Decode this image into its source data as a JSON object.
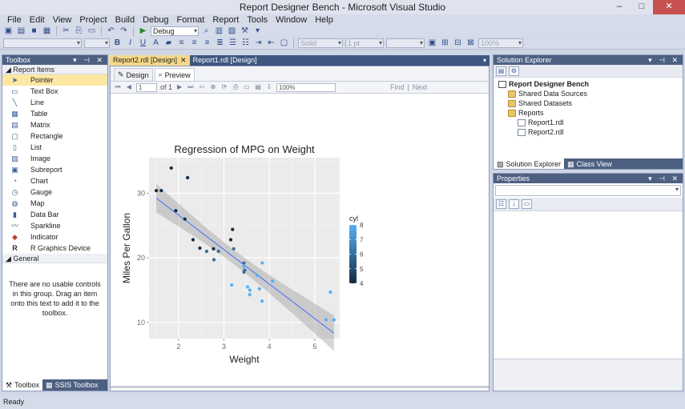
{
  "window": {
    "title": "Report Designer Bench - Microsoft Visual Studio",
    "controls": [
      "–",
      "□",
      "✕"
    ]
  },
  "menu": [
    "File",
    "Edit",
    "View",
    "Project",
    "Build",
    "Debug",
    "Format",
    "Report",
    "Tools",
    "Window",
    "Help"
  ],
  "toolbar": {
    "config": "Debug",
    "line_style": "Solid",
    "line_width": "1 pt",
    "zoom": "100%"
  },
  "toolbox": {
    "title": "Toolbox",
    "group_title": "Report Items",
    "items": [
      {
        "label": "Pointer",
        "icon": "pointer-icon"
      },
      {
        "label": "Text Box",
        "icon": "textbox-icon"
      },
      {
        "label": "Line",
        "icon": "line-icon"
      },
      {
        "label": "Table",
        "icon": "table-icon"
      },
      {
        "label": "Matrix",
        "icon": "matrix-icon"
      },
      {
        "label": "Rectangle",
        "icon": "rectangle-icon"
      },
      {
        "label": "List",
        "icon": "list-icon"
      },
      {
        "label": "Image",
        "icon": "image-icon"
      },
      {
        "label": "Subreport",
        "icon": "subreport-icon"
      },
      {
        "label": "Chart",
        "icon": "chart-icon"
      },
      {
        "label": "Gauge",
        "icon": "gauge-icon"
      },
      {
        "label": "Map",
        "icon": "map-icon"
      },
      {
        "label": "Data Bar",
        "icon": "databar-icon"
      },
      {
        "label": "Sparkline",
        "icon": "sparkline-icon"
      },
      {
        "label": "Indicator",
        "icon": "indicator-icon"
      },
      {
        "label": "R Graphics Device",
        "icon": "r-icon"
      }
    ],
    "general_title": "General",
    "general_note": "There are no usable controls in this group. Drag an item onto this text to add it to the toolbox.",
    "tabs": [
      "Toolbox",
      "SSIS Toolbox"
    ]
  },
  "documents": {
    "tabs": [
      "Report2.rdl [Design]",
      "Report1.rdl [Design]"
    ],
    "view_tabs": [
      "Design",
      "Preview"
    ]
  },
  "report_toolbar": {
    "page": "1",
    "of_label": "of 1",
    "zoom": "100%",
    "find": "Find",
    "next": "Next"
  },
  "chart_data": {
    "type": "scatter",
    "title": "Regression of MPG on Weight",
    "xlabel": "Weight",
    "ylabel": "Miles Per Gallon",
    "xlim": [
      1.35,
      5.55
    ],
    "ylim": [
      7.5,
      35.5
    ],
    "x_ticks": [
      2,
      3,
      4,
      5
    ],
    "y_ticks": [
      10,
      20,
      30
    ],
    "grid": true,
    "legend": {
      "title": "cyl",
      "ticks": [
        8,
        7,
        6,
        5,
        4
      ],
      "placement": "right",
      "color_low": "#132B43",
      "color_high": "#56B1F7"
    },
    "regression": {
      "intercept": 37.3,
      "slope": -5.34
    },
    "points": [
      {
        "x": 1.51,
        "y": 30.4,
        "cyl": 4
      },
      {
        "x": 1.62,
        "y": 30.4,
        "cyl": 4
      },
      {
        "x": 1.84,
        "y": 33.9,
        "cyl": 4
      },
      {
        "x": 1.94,
        "y": 27.3,
        "cyl": 4
      },
      {
        "x": 2.14,
        "y": 26.0,
        "cyl": 4
      },
      {
        "x": 2.2,
        "y": 32.4,
        "cyl": 4
      },
      {
        "x": 2.32,
        "y": 22.8,
        "cyl": 4
      },
      {
        "x": 2.47,
        "y": 21.5,
        "cyl": 4
      },
      {
        "x": 2.62,
        "y": 21.0,
        "cyl": 6
      },
      {
        "x": 2.78,
        "y": 19.7,
        "cyl": 6
      },
      {
        "x": 2.77,
        "y": 21.4,
        "cyl": 4
      },
      {
        "x": 2.88,
        "y": 21.0,
        "cyl": 6
      },
      {
        "x": 3.15,
        "y": 22.8,
        "cyl": 4
      },
      {
        "x": 3.19,
        "y": 24.4,
        "cyl": 4
      },
      {
        "x": 3.17,
        "y": 15.8,
        "cyl": 8
      },
      {
        "x": 3.215,
        "y": 21.4,
        "cyl": 6
      },
      {
        "x": 3.44,
        "y": 18.7,
        "cyl": 8
      },
      {
        "x": 3.44,
        "y": 19.2,
        "cyl": 6
      },
      {
        "x": 3.44,
        "y": 17.8,
        "cyl": 6
      },
      {
        "x": 3.46,
        "y": 18.1,
        "cyl": 6
      },
      {
        "x": 3.52,
        "y": 15.5,
        "cyl": 8
      },
      {
        "x": 3.57,
        "y": 14.3,
        "cyl": 8
      },
      {
        "x": 3.57,
        "y": 15.0,
        "cyl": 8
      },
      {
        "x": 3.73,
        "y": 17.3,
        "cyl": 8
      },
      {
        "x": 3.78,
        "y": 15.2,
        "cyl": 8
      },
      {
        "x": 3.84,
        "y": 13.3,
        "cyl": 8
      },
      {
        "x": 3.845,
        "y": 19.2,
        "cyl": 8
      },
      {
        "x": 4.07,
        "y": 16.4,
        "cyl": 8
      },
      {
        "x": 5.25,
        "y": 10.4,
        "cyl": 8
      },
      {
        "x": 5.345,
        "y": 14.7,
        "cyl": 8
      },
      {
        "x": 5.424,
        "y": 10.4,
        "cyl": 8
      }
    ]
  },
  "solution_explorer": {
    "title": "Solution Explorer",
    "root": "Report Designer Bench",
    "items": [
      {
        "label": "Shared Data Sources",
        "kind": "folder",
        "level": 1
      },
      {
        "label": "Shared Datasets",
        "kind": "folder",
        "level": 1
      },
      {
        "label": "Reports",
        "kind": "folder",
        "level": 1
      },
      {
        "label": "Report1.rdl",
        "kind": "file",
        "level": 2
      },
      {
        "label": "Report2.rdl",
        "kind": "file",
        "level": 2
      }
    ],
    "tabs": [
      "Solution Explorer",
      "Class View"
    ]
  },
  "properties": {
    "title": "Properties"
  },
  "status": {
    "text": "Ready"
  }
}
